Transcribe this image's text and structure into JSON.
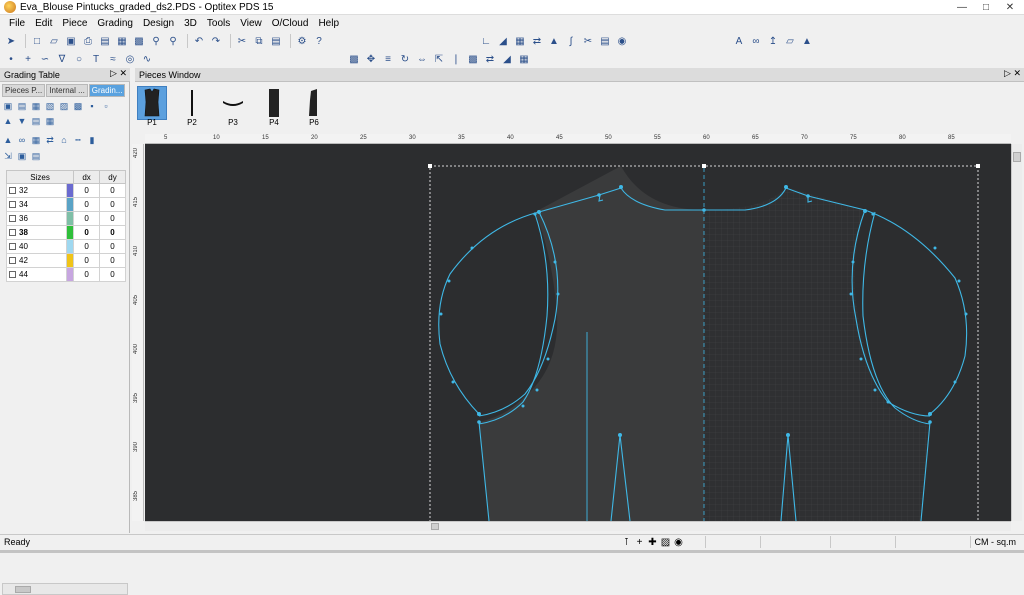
{
  "window": {
    "title": "Eva_Blouse Pintucks_graded_ds2.PDS - Optitex PDS 15",
    "controls": [
      "minimize-icon",
      "maximize-icon",
      "close-icon"
    ]
  },
  "menu": [
    "File",
    "Edit",
    "Piece",
    "Grading",
    "Design",
    "3D",
    "Tools",
    "View",
    "O/Cloud",
    "Help"
  ],
  "left_panel": {
    "title": "Grading Table",
    "tabs": [
      "Pieces P...",
      "Internal ...",
      "Gradin..."
    ],
    "active_tab": 2,
    "table": {
      "headers": [
        "Sizes",
        "dx",
        "dy"
      ],
      "rows": [
        {
          "size": "32",
          "dx": "0",
          "dy": "0",
          "color": "#6b6bd0"
        },
        {
          "size": "34",
          "dx": "0",
          "dy": "0",
          "color": "#5aa3c6"
        },
        {
          "size": "36",
          "dx": "0",
          "dy": "0",
          "color": "#7fbfa7"
        },
        {
          "size": "38",
          "dx": "0",
          "dy": "0",
          "color": "#2fbf3a",
          "bold": true
        },
        {
          "size": "40",
          "dx": "0",
          "dy": "0",
          "color": "#9fd8f0"
        },
        {
          "size": "42",
          "dx": "0",
          "dy": "0",
          "color": "#f0c419"
        },
        {
          "size": "44",
          "dx": "0",
          "dy": "0",
          "color": "#c7a6e0"
        }
      ]
    }
  },
  "pieces_window": {
    "title": "Pieces Window",
    "pieces": [
      {
        "label": "P1",
        "selected": true
      },
      {
        "label": "P2",
        "selected": false
      },
      {
        "label": "P3",
        "selected": false
      },
      {
        "label": "P4",
        "selected": false
      },
      {
        "label": "P6",
        "selected": false
      }
    ]
  },
  "rulers": {
    "top": [
      "5",
      "10",
      "15",
      "20",
      "25",
      "30",
      "35",
      "40",
      "45",
      "50",
      "55",
      "60",
      "65",
      "70",
      "75",
      "80",
      "85"
    ],
    "left": [
      "420",
      "415",
      "410",
      "405",
      "400",
      "395",
      "390",
      "385"
    ]
  },
  "status": {
    "left": "Ready",
    "unit": "CM - sq.m"
  },
  "colors": {
    "canvas_bg": "#2c2d2f",
    "piece_fill": "#3a3b3c",
    "outline": "#3fb8e6",
    "selection": "#5ca0de"
  }
}
